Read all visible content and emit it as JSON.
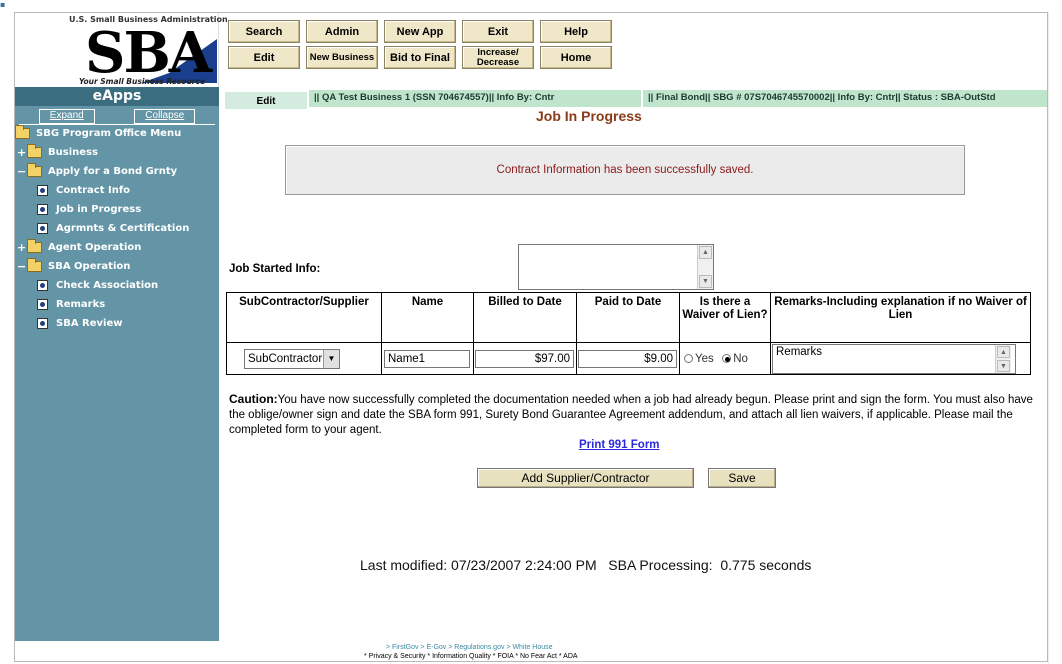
{
  "logo": {
    "agency": "U.S. Small Business Administration",
    "mark": "SBA",
    "tagline": "Your Small Business Resource"
  },
  "toolbar": {
    "row1": [
      "Search",
      "Admin",
      "New App",
      "Exit",
      "Help"
    ],
    "row2": [
      "Edit",
      "New Business",
      "Bid to Final",
      "Increase/ Decrease",
      "Home"
    ]
  },
  "sidebar": {
    "title": "eApps",
    "expand": "Expand",
    "collapse": "Collapse",
    "menu_title": "SBG Program Office Menu",
    "items": [
      {
        "label": "Business",
        "toggle": "+"
      },
      {
        "label": "Apply for a Bond Grnty",
        "toggle": "−"
      },
      {
        "label": "Contract Info"
      },
      {
        "label": "Job in Progress"
      },
      {
        "label": "Agrmnts & Certification"
      },
      {
        "label": "Agent Operation",
        "toggle": "+"
      },
      {
        "label": "SBA Operation",
        "toggle": "−"
      },
      {
        "label": "Check Association"
      },
      {
        "label": "Remarks"
      },
      {
        "label": "SBA Review"
      }
    ]
  },
  "status": {
    "edit": "Edit",
    "info1": "|| QA Test Business 1 (SSN 704674557)|| Info By:  Cntr",
    "info2": "|| Final Bond|| SBG # 07S7046745570002|| Info By: Cntr|| Status : SBA-OutStd"
  },
  "page_title": "Job In Progress",
  "message": "Contract Information has been successfully saved.",
  "job_started_label": "Job Started Info:",
  "table": {
    "headers": [
      "SubContractor/Supplier",
      "Name",
      "Billed to Date",
      "Paid to Date",
      "Is there a Waiver of Lien?",
      "Remarks-Including explanation if no Waiver of Lien"
    ],
    "row": {
      "type": "SubContractor",
      "name": "Name1",
      "billed": "$97.00",
      "paid": "$9.00",
      "yes": "Yes",
      "no": "No",
      "remarks": "Remarks"
    }
  },
  "caution": {
    "bold": "Caution:",
    "text": "You have now successfully completed the documentation needed when a job had already begun. Please print and sign the form. You must also have the oblige/owner sign and date the SBA form 991, Surety Bond Guarantee Agreement addendum, and attach all lien waivers, if applicable. Please mail the completed form to your agent."
  },
  "print_link": "Print 991 Form",
  "buttons": {
    "add": "Add Supplier/Contractor",
    "save": "Save"
  },
  "last_modified": "Last modified: 07/23/2007 2:24:00 PM   SBA Processing:  0.775 seconds",
  "footer": {
    "links": "> FirstGov    > E-Gov    > Regulations.gov    > White House",
    "sub": "* Privacy & Security  * Information Quality  * FOIA  * No Fear Act  * ADA"
  }
}
